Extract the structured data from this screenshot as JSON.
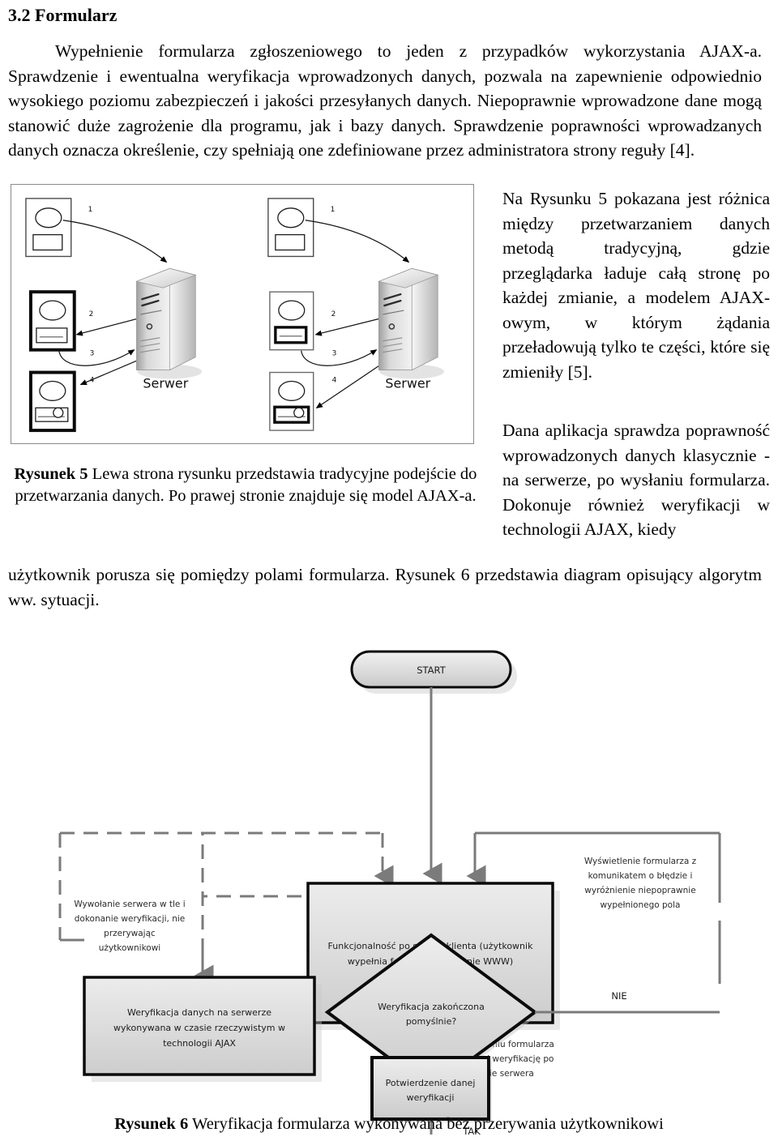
{
  "document": {
    "section_number_title": "3.2 Formularz",
    "intro_paragraph": "Wypełnienie formularza zgłoszeniowego to jeden z przypadków wykorzystania AJAX-a. Sprawdzenie i ewentualna weryfikacja wprowadzonych danych, pozwala na zapewnienie odpowiednio wysokiego poziomu zabezpieczeń i jakości przesyłanych danych. Niepoprawnie wprowadzone dane mogą stanowić duże zagrożenie dla programu, jak i bazy danych. Sprawdzenie poprawności wprowadzanych danych oznacza określenie, czy spełniają one zdefiniowane przez administratora strony reguły [4].",
    "right_paragraph_1": "Na Rysunku 5 pokazana jest różnica między przetwarzaniem danych metodą tradycyjną, gdzie przeglądarka ładuje całą stronę po każdej zmianie, a modelem AJAX-owym, w którym żądania przeładowują tylko te części, które się zmieniły [5].",
    "right_paragraph_2": "Dana aplikacja sprawdza poprawność wprowadzonych danych klasycznie - na serwerze, po wysłaniu formularza. Dokonuje również weryfikacji w technologii AJAX, kiedy",
    "tail_paragraph": "użytkownik porusza się pomiędzy polami formularza. Rysunek 6 przedstawia diagram opisujący algorytm ww. sytuacji."
  },
  "figure5": {
    "caption_lead": "Rysunek 5",
    "caption_text": "Lewa strona rysunku przedstawia tradycyjne podejście do przetwarzania danych. Po prawej stronie znajduje się model AJAX-a.",
    "server_label": "Serwer",
    "step_numbers": [
      "1",
      "2",
      "3",
      "4"
    ],
    "panels": [
      {
        "side": "left",
        "model": "tradycyjny"
      },
      {
        "side": "right",
        "model": "AJAX"
      }
    ]
  },
  "figure6": {
    "caption_lead": "Rysunek 6",
    "caption_text": "Weryfikacja formularza wykonywana bez przerywania użytkownikowi",
    "nodes": {
      "start": "START",
      "client": "Funkcjonalność po stronie klienta (użytkownik wypełnia formularz na stronie WWW)",
      "client_line1": "Funkcjonalność po stronie klienta (użytkownik",
      "client_line2": "wypełnia formularz na stronie WWW)",
      "server_verify_line1": "Weryfikacja danych na serwerze",
      "server_verify_line2": "wykonywana w czasie rzeczywistym w",
      "server_verify_line3": "technologii AJAX",
      "decision_line1": "Weryfikacja zakończona",
      "decision_line2": "pomyślnie?",
      "confirm_line1": "Potwierdzenie danej",
      "confirm_line2": "weryfikacji"
    },
    "annotations": {
      "left_note_line1": "Wywołanie serwera w tle i",
      "left_note_line2": "dokonanie weryfikacji, nie",
      "left_note_line3": "przerywając",
      "left_note_line4": "użytkownikowi",
      "right_note_line1": "Wyświetlenie formularza z",
      "right_note_line2": "komunikatem o błędzie i",
      "right_note_line3": "wyróżnienie niepoprawnie",
      "right_note_line4": "wypełnionego pola",
      "mid_note_line1": "Przy wysłaniu formularza",
      "mid_note_line2": "– wykonaj weryfikację po",
      "mid_note_line3": "stronie serwera",
      "branch_no": "NIE",
      "branch_yes": "TAK"
    }
  },
  "colors": {
    "page_background": "#ffffff",
    "text": "#000000",
    "figure_frame_border": "#8a8a8a",
    "flow_node_fill_top": "#eeeeee",
    "flow_node_fill_bottom": "#cfcfcf",
    "flow_node_border": "#000000",
    "connector_gray": "#7b7b7b",
    "server_gradient_light": "#f4f4f4",
    "server_gradient_dark": "#a9a9a9"
  }
}
